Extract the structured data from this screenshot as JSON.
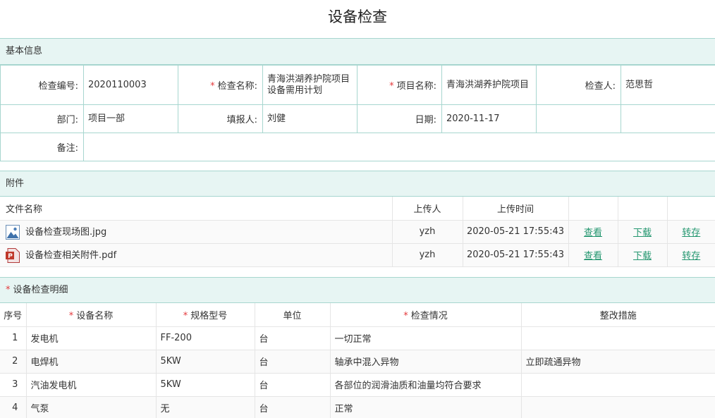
{
  "page_title": "设备检查",
  "basic": {
    "section_title": "基本信息",
    "inspection_no_label": "检查编号:",
    "inspection_no": "2020110003",
    "inspection_name_label": "检查名称:",
    "inspection_name": "青海洪湖养护院项目设备需用计划",
    "project_name_label": "项目名称:",
    "project_name": "青海洪湖养护院项目",
    "inspector_label": "检查人:",
    "inspector": "范思哲",
    "dept_label": "部门:",
    "dept": "项目一部",
    "reporter_label": "填报人:",
    "reporter": "刘健",
    "date_label": "日期:",
    "date": "2020-11-17",
    "remark_label": "备注:",
    "remark": ""
  },
  "attachments": {
    "section_title": "附件",
    "headers": {
      "file_name": "文件名称",
      "uploader": "上传人",
      "upload_time": "上传时间"
    },
    "files": [
      {
        "name": "设备检查现场图.jpg",
        "icon": "image-file-icon",
        "uploader": "yzh",
        "time": "2020-05-21 17:55:43",
        "view": "查看",
        "download": "下载",
        "transfer": "转存"
      },
      {
        "name": "设备检查相关附件.pdf",
        "icon": "pdf-file-icon",
        "uploader": "yzh",
        "time": "2020-05-21 17:55:43",
        "view": "查看",
        "download": "下载",
        "transfer": "转存"
      }
    ]
  },
  "details": {
    "section_title": "设备检查明细",
    "headers": {
      "no": "序号",
      "name": "设备名称",
      "spec": "规格型号",
      "unit": "单位",
      "status": "检查情况",
      "fix": "整改措施"
    },
    "rows": [
      {
        "no": "1",
        "name": "发电机",
        "spec": "FF-200",
        "unit": "台",
        "status": "一切正常",
        "fix": ""
      },
      {
        "no": "2",
        "name": "电焊机",
        "spec": "5KW",
        "unit": "台",
        "status": "轴承中混入异物",
        "fix": "立即疏通异物"
      },
      {
        "no": "3",
        "name": "汽油发电机",
        "spec": "5KW",
        "unit": "台",
        "status": "各部位的润滑油质和油量均符合要求",
        "fix": ""
      },
      {
        "no": "4",
        "name": "气泵",
        "spec": "无",
        "unit": "台",
        "status": "正常",
        "fix": ""
      }
    ]
  },
  "required_mark": "*",
  "colors": {
    "accent": "#23966f",
    "section_bg": "#e7f5f3",
    "border": "#a7d6cf",
    "required": "#e4393c"
  }
}
